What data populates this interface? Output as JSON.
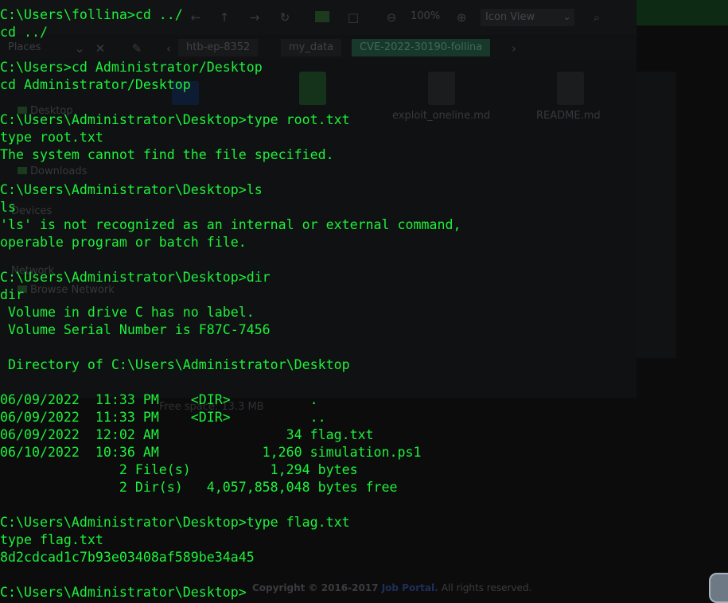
{
  "background_app": {
    "toolbar": {
      "zoom": "100%",
      "view_mode": "Icon View"
    },
    "places_label": "Places",
    "breadcrumbs": [
      "htb-ep-8352",
      "my_data",
      "CVE-2022-30190-follina"
    ],
    "sidebar": [
      "Desktop",
      "Downloads",
      "Devices",
      "Network",
      "Browse Network"
    ],
    "files": [
      "exploit_oneline.md",
      "README.md"
    ],
    "statusbar": "Free space: 13.3 MB",
    "copyright": {
      "prefix": "Copyright © 2016-2017",
      "link": "Job Portal.",
      "suffix": "All rights reserved."
    }
  },
  "terminal": {
    "lines": [
      "C:\\Users\\follina>cd ../",
      "cd ../",
      "",
      "C:\\Users>cd Administrator/Desktop",
      "cd Administrator/Desktop",
      "",
      "C:\\Users\\Administrator\\Desktop>type root.txt",
      "type root.txt",
      "The system cannot find the file specified.",
      "",
      "C:\\Users\\Administrator\\Desktop>ls",
      "ls",
      "'ls' is not recognized as an internal or external command,",
      "operable program or batch file.",
      "",
      "C:\\Users\\Administrator\\Desktop>dir",
      "dir",
      " Volume in drive C has no label.",
      " Volume Serial Number is F87C-7456",
      "",
      " Directory of C:\\Users\\Administrator\\Desktop",
      "",
      "06/09/2022  11:33 PM    <DIR>          .",
      "06/09/2022  11:33 PM    <DIR>          ..",
      "06/09/2022  12:02 AM                34 flag.txt",
      "06/10/2022  10:36 AM             1,260 simulation.ps1",
      "               2 File(s)          1,294 bytes",
      "               2 Dir(s)   4,057,858,048 bytes free",
      "",
      "C:\\Users\\Administrator\\Desktop>type flag.txt",
      "type flag.txt",
      "8d2cdcad1c7b93e03408af589be34a45",
      "",
      "C:\\Users\\Administrator\\Desktop>"
    ]
  }
}
